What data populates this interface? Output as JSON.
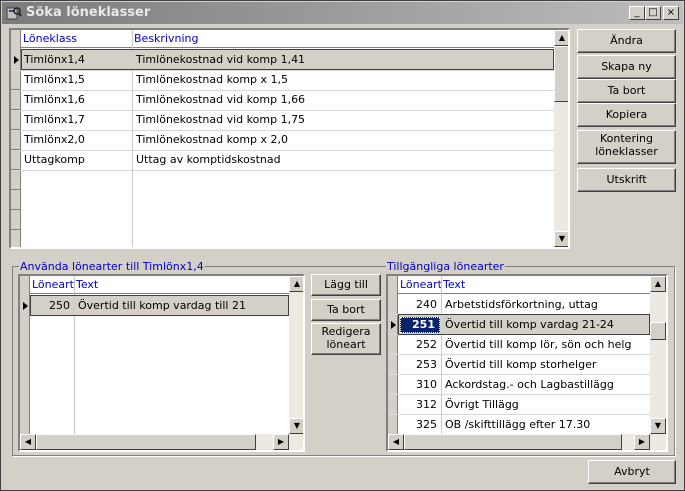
{
  "window": {
    "title": "Söka löneklasser"
  },
  "top_grid": {
    "columns": [
      "Löneklass",
      "Beskrivning"
    ],
    "rows": [
      [
        "Timlönx1,4",
        "Timlönekostnad vid komp 1,41"
      ],
      [
        "Timlönx1,5",
        "Timlönekostnad komp x 1,5"
      ],
      [
        "Timlönx1,6",
        "Timlönekostnad vid komp 1,66"
      ],
      [
        "Timlönx1,7",
        "Timlönekostnad vid komp 1,75"
      ],
      [
        "Timlönx2,0",
        "Timlönekostnad komp x 2,0"
      ],
      [
        "Uttagkomp",
        "Uttag av komptidskostnad"
      ]
    ]
  },
  "right_buttons": {
    "andra": "Ändra",
    "skapa_ny": "Skapa ny",
    "ta_bort": "Ta bort",
    "kopiera": "Kopiera",
    "kontering_line1": "Kontering",
    "kontering_line2": "löneklasser",
    "utskrift": "Utskrift"
  },
  "used": {
    "label": "Använda lönearter till Timlönx1,4",
    "columns": [
      "Löneart",
      "Text"
    ],
    "rows": [
      [
        "250",
        "Övertid till komp vardag till 21"
      ]
    ]
  },
  "middle_buttons": {
    "lagg_till": "Lägg till",
    "ta_bort": "Ta bort",
    "redigera_line1": "Redigera",
    "redigera_line2": "löneart"
  },
  "available": {
    "label": "Tillgängliga lönearter",
    "columns": [
      "Löneart",
      "Text"
    ],
    "rows": [
      [
        "240",
        "Arbetstidsförkortning, uttag"
      ],
      [
        "251",
        "Övertid till komp vardag 21-24"
      ],
      [
        "252",
        "Övertid till komp lör, sön och helg"
      ],
      [
        "253",
        "Övertid till komp storhelger"
      ],
      [
        "310",
        "Ackordstag.- och Lagbastillägg"
      ],
      [
        "312",
        "Övrigt Tillägg"
      ],
      [
        "325",
        "OB /skifttillägg efter 17.30"
      ]
    ]
  },
  "bottom": {
    "avbryt": "Avbryt"
  },
  "icons": [
    "app-icon",
    "minimize-icon",
    "maximize-icon",
    "close-icon",
    "row-pointer-icon",
    "scroll-up-icon",
    "scroll-down-icon",
    "scroll-left-icon",
    "scroll-right-icon"
  ]
}
